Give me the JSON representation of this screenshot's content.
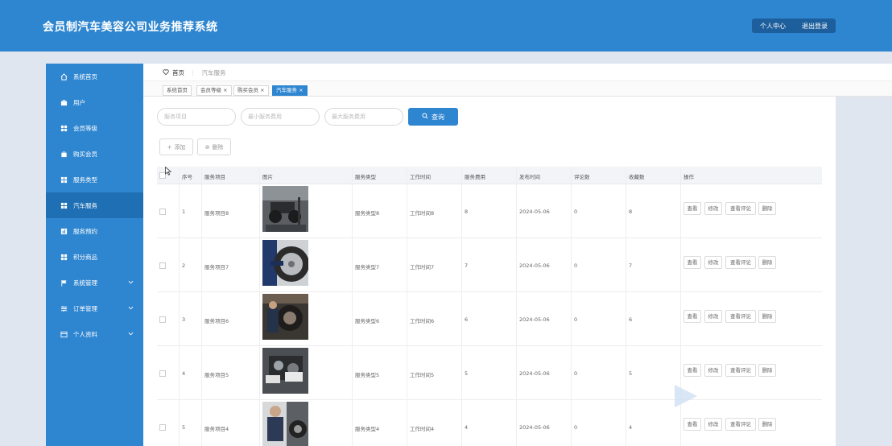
{
  "header": {
    "title": "会员制汽车美容公司业务推荐系统",
    "profile": "个人中心",
    "logout": "退出登录"
  },
  "sidebar": {
    "items": [
      {
        "label": "系统首页",
        "icon": "home-icon"
      },
      {
        "label": "用户",
        "icon": "briefcase-icon"
      },
      {
        "label": "会员等级",
        "icon": "grid-icon"
      },
      {
        "label": "购买会员",
        "icon": "bag-icon"
      },
      {
        "label": "服务类型",
        "icon": "grid-icon"
      },
      {
        "label": "汽车服务",
        "icon": "grid-icon",
        "active": true
      },
      {
        "label": "服务预约",
        "icon": "chart-icon"
      },
      {
        "label": "积分商品",
        "icon": "grid-icon"
      },
      {
        "label": "系统管理",
        "icon": "flag-icon",
        "expandable": true
      },
      {
        "label": "订单管理",
        "icon": "sliders-icon",
        "expandable": true
      },
      {
        "label": "个人资料",
        "icon": "card-icon",
        "expandable": true
      }
    ]
  },
  "breadcrumb": {
    "home": "首页",
    "current": "汽车服务"
  },
  "tabs": [
    {
      "label": "系统首页",
      "closable": false
    },
    {
      "label": "会员等级",
      "closable": true
    },
    {
      "label": "购买会员",
      "closable": true
    },
    {
      "label": "汽车服务",
      "closable": true,
      "active": true
    }
  ],
  "search": {
    "item_placeholder": "服务项目",
    "min_fee_placeholder": "最小服务费用",
    "max_fee_placeholder": "最大服务费用",
    "button": "查询"
  },
  "actions": {
    "add": "添加",
    "delete": "删除"
  },
  "table": {
    "columns": [
      "序号",
      "服务项目",
      "图片",
      "服务类型",
      "工作时间",
      "服务费用",
      "发布时间",
      "评论数",
      "收藏数",
      "操作"
    ],
    "row_buttons": [
      "查看",
      "修改",
      "查看评论",
      "删除"
    ],
    "rows": [
      {
        "index": "1",
        "item": "服务项目8",
        "type": "服务类型8",
        "time": "工作时间8",
        "fee": "8",
        "date": "2024-05-06",
        "comments": "0",
        "favorites": "8"
      },
      {
        "index": "2",
        "item": "服务项目7",
        "type": "服务类型7",
        "time": "工作时间7",
        "fee": "7",
        "date": "2024-05-06",
        "comments": "0",
        "favorites": "7"
      },
      {
        "index": "3",
        "item": "服务项目6",
        "type": "服务类型6",
        "time": "工作时间6",
        "fee": "6",
        "date": "2024-05-06",
        "comments": "0",
        "favorites": "6"
      },
      {
        "index": "4",
        "item": "服务项目5",
        "type": "服务类型5",
        "time": "工作时间5",
        "fee": "5",
        "date": "2024-05-06",
        "comments": "0",
        "favorites": "5"
      },
      {
        "index": "5",
        "item": "服务项目4",
        "type": "服务类型4",
        "time": "工作时间4",
        "fee": "4",
        "date": "2024-05-06",
        "comments": "0",
        "favorites": "4"
      }
    ]
  },
  "colors": {
    "primary": "#2f86d0",
    "active_nav": "#1f6fb4",
    "page_bg": "#dfe6ef"
  }
}
